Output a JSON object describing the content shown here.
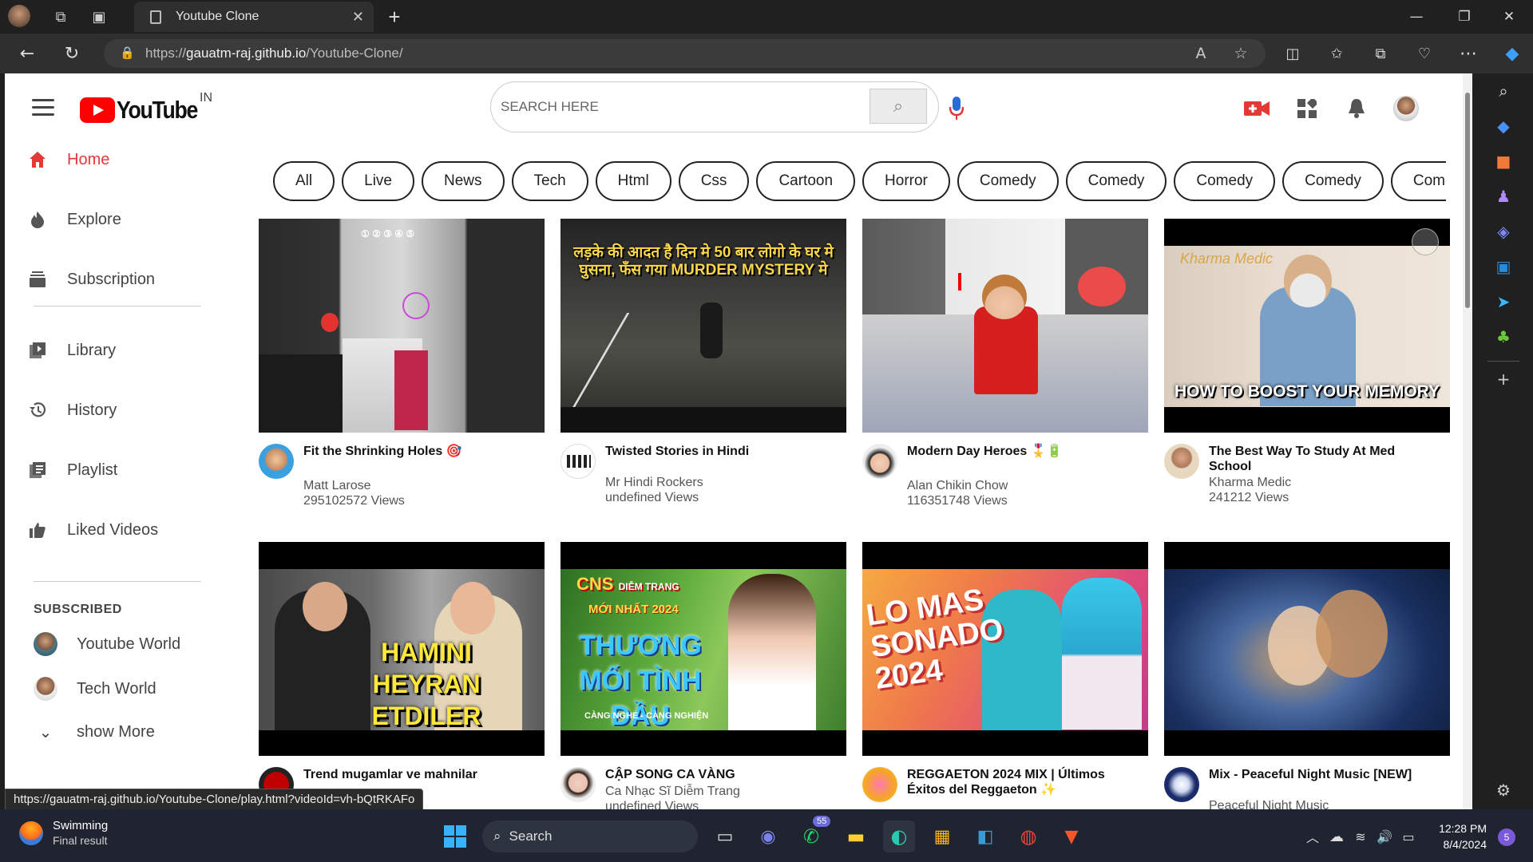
{
  "browser": {
    "tab_title": "Youtube Clone",
    "url_prefix": "https://",
    "url_host": "gauatm-raj.github.io",
    "url_path": "/Youtube-Clone/",
    "status_url": "https://gauatm-raj.github.io/Youtube-Clone/play.html?videoId=vh-bQtRKAFo"
  },
  "header": {
    "logo_text": "YouTube",
    "country_code": "IN",
    "search_placeholder": "SEARCH HERE"
  },
  "sidebar": {
    "items": [
      {
        "label": "Home",
        "icon": "home-icon"
      },
      {
        "label": "Explore",
        "icon": "explore-icon"
      },
      {
        "label": "Subscription",
        "icon": "subscription-icon"
      },
      {
        "label": "Library",
        "icon": "library-icon"
      },
      {
        "label": "History",
        "icon": "history-icon"
      },
      {
        "label": "Playlist",
        "icon": "playlist-icon"
      },
      {
        "label": "Liked Videos",
        "icon": "like-icon"
      }
    ],
    "subscribed_heading": "SUBSCRIBED",
    "subscriptions": [
      {
        "label": "Youtube World"
      },
      {
        "label": "Tech World"
      }
    ],
    "show_more": "show More"
  },
  "chips": [
    "All",
    "Live",
    "News",
    "Tech",
    "Html",
    "Css",
    "Cartoon",
    "Horror",
    "Comedy",
    "Comedy",
    "Comedy",
    "Comedy",
    "Comedy"
  ],
  "videos": [
    {
      "title": "Fit the Shrinking Holes 🎯",
      "channel": "Matt Larose",
      "views": "295102572 Views",
      "accent": "#3aa0e0"
    },
    {
      "title": "Twisted Stories in Hindi",
      "channel": "Mr Hindi Rockers",
      "views": "undefined Views",
      "accent": "#222222"
    },
    {
      "title": "Modern Day Heroes 🎖️🔋",
      "channel": "Alan Chikin Chow",
      "views": "116351748 Views",
      "accent": "#d0d0d0"
    },
    {
      "title": "The Best Way To Study At Med School",
      "channel": "Kharma Medic",
      "views": "241212 Views",
      "accent": "#b08a6a"
    },
    {
      "title": "Trend mugamlar ve mahnilar",
      "channel": "",
      "views": "",
      "accent": "#c00000"
    },
    {
      "title": "CẬP SONG CA VÀNG",
      "channel": "Ca Nhạc Sĩ Diễm Trang",
      "views": "undefined Views",
      "accent": "#e8c0c0"
    },
    {
      "title": "REGGAETON 2024 MIX | Últimos Éxitos del Reggaeton ✨",
      "channel": "",
      "views": "",
      "accent": "#f5a623"
    },
    {
      "title": "Mix - Peaceful Night Music [NEW]",
      "channel": "Peaceful Night Music",
      "views": "",
      "accent": "#1a2a6a"
    }
  ],
  "thumb_texts": {
    "v2": "लड़के की आदत है दिन मे 50 बार लोगो के घर मे घुसना, फँस गया MURDER MYSTERY मे",
    "v4": "HOW TO BOOST YOUR MEMORY",
    "v5": "HAMINI HEYRAN ETDILER",
    "v6_brand": "CNS",
    "v6_name": "DIỄM TRANG",
    "v6_sub": "MỚI NHẤT 2024",
    "v6_title": "THƯƠNG MỐI TÌNH ĐẦU",
    "v6_foot": "CÀNG NGHE - CÀNG NGHIỆN",
    "v7": "LO MAS SONADO 2024"
  },
  "taskbar": {
    "weather_title": "Swimming",
    "weather_sub": "Final result",
    "search_label": "Search",
    "whatsapp_badge": "55",
    "time": "12:28 PM",
    "date": "8/4/2024",
    "notification_count": "5"
  },
  "colors": {
    "accent": "#ff0000",
    "active_sidebar": "#e53935"
  }
}
